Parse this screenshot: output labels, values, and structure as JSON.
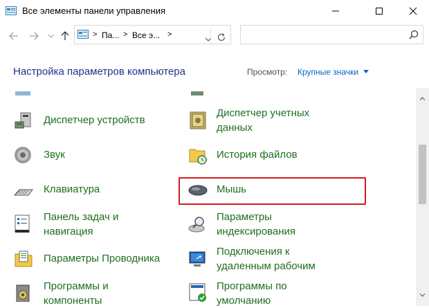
{
  "window": {
    "title": "Все элементы панели управления",
    "controls": {
      "minimize": "—",
      "maximize": "☐",
      "close": "✕"
    }
  },
  "address": {
    "crumbs": [
      "Па...",
      "Все э..."
    ],
    "separators": [
      ">",
      ">",
      ">"
    ],
    "search_placeholder": ""
  },
  "header": {
    "heading": "Настройка параметров компьютера",
    "viewby_label": "Просмотр:",
    "viewby_value": "Крупные значки"
  },
  "items": [
    {
      "label_line1": "Диспетчер устройств",
      "label_line2": "",
      "icon": "device-manager-icon"
    },
    {
      "label_line1": "Диспетчер учетных",
      "label_line2": "данных",
      "icon": "credential-manager-icon"
    },
    {
      "label_line1": "Звук",
      "label_line2": "",
      "icon": "speaker-icon"
    },
    {
      "label_line1": "История файлов",
      "label_line2": "",
      "icon": "file-history-icon"
    },
    {
      "label_line1": "Клавиатура",
      "label_line2": "",
      "icon": "keyboard-icon"
    },
    {
      "label_line1": "Мышь",
      "label_line2": "",
      "icon": "mouse-icon"
    },
    {
      "label_line1": "Панель задач и",
      "label_line2": "навигация",
      "icon": "taskbar-icon"
    },
    {
      "label_line1": "Параметры",
      "label_line2": "индексирования",
      "icon": "indexing-icon"
    },
    {
      "label_line1": "Параметры Проводника",
      "label_line2": "",
      "icon": "explorer-options-icon"
    },
    {
      "label_line1": "Подключения к",
      "label_line2": "удаленным рабочим",
      "icon": "remote-desktop-icon"
    },
    {
      "label_line1": "Программы и",
      "label_line2": "компоненты",
      "icon": "programs-icon"
    },
    {
      "label_line1": "Программы по",
      "label_line2": "умолчанию",
      "icon": "default-programs-icon"
    }
  ],
  "colors": {
    "heading": "#1e3287",
    "link_green": "#1f6e1f",
    "accent_blue": "#0066cc",
    "highlight_red": "#d01b1b"
  }
}
